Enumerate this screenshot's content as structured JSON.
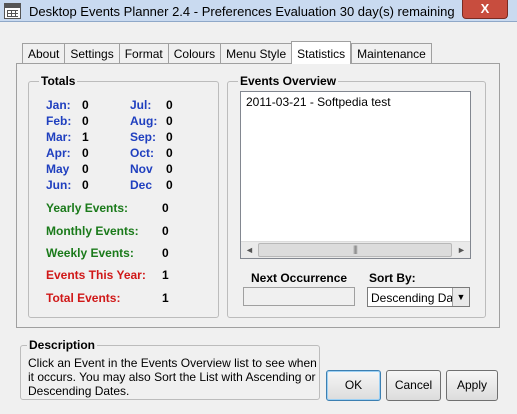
{
  "window": {
    "title": "Desktop Events Planner 2.4 - Preferences  Evaluation 30 day(s) remaining",
    "close_glyph": "X"
  },
  "tabs": [
    {
      "label": "About"
    },
    {
      "label": "Settings"
    },
    {
      "label": "Format"
    },
    {
      "label": "Colours"
    },
    {
      "label": "Menu Style"
    },
    {
      "label": "Statistics",
      "active": true
    },
    {
      "label": "Maintenance"
    }
  ],
  "totals": {
    "title": "Totals",
    "months": [
      {
        "label": "Jan:",
        "value": "0"
      },
      {
        "label": "Feb:",
        "value": "0"
      },
      {
        "label": "Mar:",
        "value": "1"
      },
      {
        "label": "Apr:",
        "value": "0"
      },
      {
        "label": "May",
        "value": "0"
      },
      {
        "label": "Jun:",
        "value": "0"
      },
      {
        "label": "Jul:",
        "value": "0"
      },
      {
        "label": "Aug:",
        "value": "0"
      },
      {
        "label": "Sep:",
        "value": "0"
      },
      {
        "label": "Oct:",
        "value": "0"
      },
      {
        "label": "Nov",
        "value": "0"
      },
      {
        "label": "Dec",
        "value": "0"
      }
    ],
    "summary": [
      {
        "label": "Yearly Events:",
        "value": "0"
      },
      {
        "label": "Monthly Events:",
        "value": "0"
      },
      {
        "label": "Weekly Events:",
        "value": "0"
      },
      {
        "label": "Events This Year:",
        "value": "1"
      },
      {
        "label": "Total Events:",
        "value": "1"
      }
    ]
  },
  "overview": {
    "title": "Events Overview",
    "items": [
      "2011-03-21 - Softpedia test"
    ],
    "scrollbar": {
      "left_arrow": "◄",
      "right_arrow": "►",
      "grip": "|||"
    },
    "next_occurrence_label": "Next Occurrence",
    "next_occurrence_value": "",
    "sort_by_label": "Sort By:",
    "sort_by_value": "Descending Date",
    "sort_drop_glyph": "▼"
  },
  "description": {
    "title": "Description",
    "text": "Click an Event in the Events Overview list to see when it occurs. You may also Sort the List with Ascending or Descending Dates."
  },
  "buttons": {
    "ok": "OK",
    "cancel": "Cancel",
    "apply": "Apply"
  },
  "colors": {
    "month_label": "#1f3fbf",
    "periodic_label": "#1a7a1a",
    "total_label": "#d01818"
  }
}
